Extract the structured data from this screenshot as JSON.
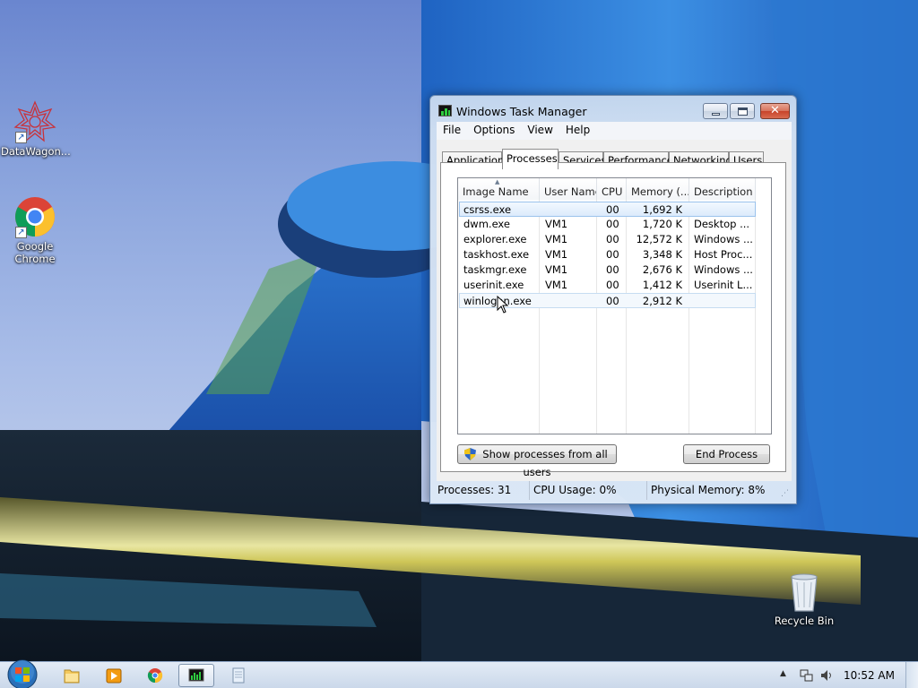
{
  "desktop": {
    "icons": [
      {
        "label": "DataWagon...",
        "icon": "datawagon-icon"
      },
      {
        "label": "Google Chrome",
        "icon": "chrome-icon"
      },
      {
        "label": "Recycle Bin",
        "icon": "recycle-bin-icon"
      }
    ]
  },
  "window": {
    "title": "Windows Task Manager",
    "menu": [
      "File",
      "Options",
      "View",
      "Help"
    ],
    "tabs": [
      "Applications",
      "Processes",
      "Services",
      "Performance",
      "Networking",
      "Users"
    ],
    "active_tab": "Processes",
    "columns": [
      "Image Name",
      "User Name",
      "CPU",
      "Memory (...",
      "Description"
    ],
    "rows": [
      {
        "image": "csrss.exe",
        "user": "",
        "cpu": "00",
        "memory": "1,692 K",
        "description": ""
      },
      {
        "image": "dwm.exe",
        "user": "VM1",
        "cpu": "00",
        "memory": "1,720 K",
        "description": "Desktop ..."
      },
      {
        "image": "explorer.exe",
        "user": "VM1",
        "cpu": "00",
        "memory": "12,572 K",
        "description": "Windows ..."
      },
      {
        "image": "taskhost.exe",
        "user": "VM1",
        "cpu": "00",
        "memory": "3,348 K",
        "description": "Host Proc..."
      },
      {
        "image": "taskmgr.exe",
        "user": "VM1",
        "cpu": "00",
        "memory": "2,676 K",
        "description": "Windows ..."
      },
      {
        "image": "userinit.exe",
        "user": "VM1",
        "cpu": "00",
        "memory": "1,412 K",
        "description": "Userinit L..."
      },
      {
        "image": "winlogon.exe",
        "user": "",
        "cpu": "00",
        "memory": "2,912 K",
        "description": ""
      }
    ],
    "show_all_button": "Show processes from all users",
    "end_process_button": "End Process",
    "status": {
      "processes": "Processes: 31",
      "cpu": "CPU Usage: 0%",
      "memory": "Physical Memory: 8%"
    }
  },
  "taskbar": {
    "items": [
      "start-orb-icon",
      "explorer-icon",
      "media-player-icon",
      "chrome-icon",
      "task-manager-icon",
      "notepad-icon"
    ],
    "clock": "10:52 AM"
  },
  "colors": {
    "selection": "#dcebfc",
    "window_frame": "#c6d8ee",
    "wallpaper_blue": "#2f7fd6"
  }
}
